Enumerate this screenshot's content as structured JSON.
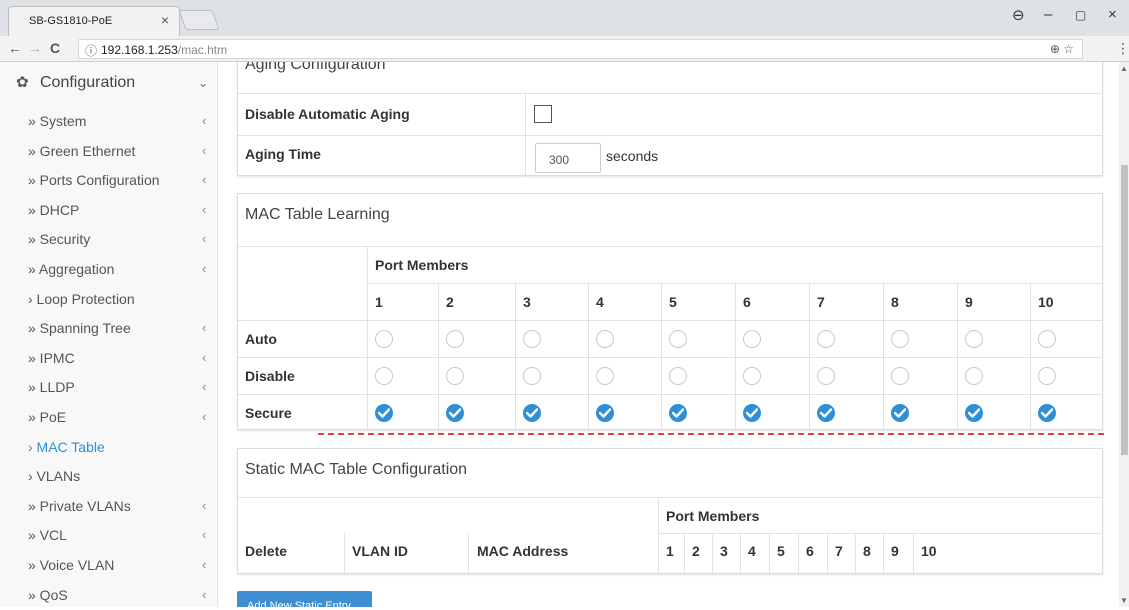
{
  "browser": {
    "tab_title": "SB-GS1810-PoE",
    "tab_close": "×",
    "url_host": "192.168.1.253",
    "url_path": "/mac.htm",
    "info_icon": "ⓘ",
    "right_icons": "⊕ ☆",
    "menu_dots": "⋮",
    "back": "←",
    "forward": "→",
    "reload": "C",
    "window_user": "⊖",
    "window_min": "–",
    "window_max": "▢",
    "window_close": "×"
  },
  "sidebar": {
    "header": "Configuration",
    "header_icon": "gear-icon",
    "header_chevron": "⌄",
    "items": [
      {
        "label": "» System",
        "arrow": "‹"
      },
      {
        "label": "» Green Ethernet",
        "arrow": "‹"
      },
      {
        "label": "» Ports Configuration",
        "arrow": "‹"
      },
      {
        "label": "» DHCP",
        "arrow": "‹"
      },
      {
        "label": "» Security",
        "arrow": "‹"
      },
      {
        "label": "» Aggregation",
        "arrow": "‹"
      },
      {
        "label": "› Loop Protection",
        "arrow": ""
      },
      {
        "label": "» Spanning Tree",
        "arrow": "‹"
      },
      {
        "label": "» IPMC",
        "arrow": "‹"
      },
      {
        "label": "» LLDP",
        "arrow": "‹"
      },
      {
        "label": "» PoE",
        "arrow": "‹"
      },
      {
        "label": "› MAC Table",
        "arrow": ""
      },
      {
        "label": "› VLANs",
        "arrow": ""
      },
      {
        "label": "» Private VLANs",
        "arrow": "‹"
      },
      {
        "label": "» VCL",
        "arrow": "‹"
      },
      {
        "label": "» Voice VLAN",
        "arrow": "‹"
      },
      {
        "label": "» QoS",
        "arrow": "‹"
      }
    ],
    "active_item": "› MAC Table"
  },
  "aging": {
    "title": "Aging Configuration",
    "disable_label": "Disable Automatic Aging",
    "disable_checked": false,
    "time_label": "Aging Time",
    "time_value": "300",
    "time_unit": "seconds"
  },
  "learning": {
    "title": "MAC Table Learning",
    "port_members_label": "Port Members",
    "ports": [
      "1",
      "2",
      "3",
      "4",
      "5",
      "6",
      "7",
      "8",
      "9",
      "10"
    ],
    "rows": [
      {
        "label": "Auto",
        "selected": [
          false,
          false,
          false,
          false,
          false,
          false,
          false,
          false,
          false,
          false
        ]
      },
      {
        "label": "Disable",
        "selected": [
          false,
          false,
          false,
          false,
          false,
          false,
          false,
          false,
          false,
          false
        ]
      },
      {
        "label": "Secure",
        "selected": [
          true,
          true,
          true,
          true,
          true,
          true,
          true,
          true,
          true,
          true
        ]
      }
    ]
  },
  "static": {
    "title": "Static MAC Table Configuration",
    "port_members_label": "Port Members",
    "col_delete": "Delete",
    "col_vlan": "VLAN ID",
    "col_mac": "MAC Address",
    "ports": [
      "1",
      "2",
      "3",
      "4",
      "5",
      "6",
      "7",
      "8",
      "9",
      "10"
    ],
    "add_button": "Add New Static Entry"
  },
  "colors": {
    "accent": "#2f8fd6",
    "highlight_dash": "#e0433f",
    "button": "#3d8fd1"
  }
}
